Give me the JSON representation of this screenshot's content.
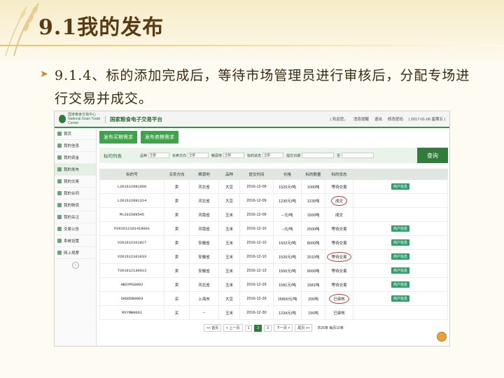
{
  "slide": {
    "title": "9.1我的发布",
    "bullet": "9.1.4、标的添加完成后，等待市场管理员进行审核后，分配专场进行交易并成交。"
  },
  "app": {
    "org": "国家粮食交易中心",
    "org_en": "National Grain Trade Center",
    "platform": "国家粮食电子交易平台",
    "welcome": "| 欢迎您，",
    "msg": "消息提醒",
    "logout": "退出",
    "change_pwd": "修改密码",
    "date": "| 2017-01-06 星期五 |"
  },
  "sidebar": {
    "items": [
      {
        "label": "首页"
      },
      {
        "label": "我的信息"
      },
      {
        "label": "我的资金"
      },
      {
        "label": "我的发布"
      },
      {
        "label": "我的交易"
      },
      {
        "label": "我的合同"
      },
      {
        "label": "我的物流"
      },
      {
        "label": "我的关注"
      },
      {
        "label": "交易公告"
      },
      {
        "label": "系统设置"
      },
      {
        "label": "网上观摩"
      }
    ]
  },
  "tabs": {
    "buy": "发布买粮需求",
    "sell": "发布卖粮需求"
  },
  "filter": {
    "title": "标的列表",
    "variety_label": "品种",
    "variety_val": "全部",
    "direction_label": "买卖方向",
    "direction_val": "全部",
    "origin_label": "粮源地",
    "origin_val": "全部",
    "status_label": "标的状态",
    "status_val": "全部",
    "date_label": "提交日期",
    "to_label": "至",
    "query": "查询"
  },
  "table": {
    "headers": [
      "标的号",
      "买卖方向",
      "粮源地",
      "品种",
      "提交时间",
      "价格",
      "标的数量",
      "标的状态",
      ""
    ],
    "rows": [
      {
        "id": "L201612091050",
        "dir": "卖",
        "origin": "河北省",
        "variety": "大豆",
        "date": "2016-12-09",
        "price": "1520元/吨",
        "qty": "1000吨",
        "status": "等待交易",
        "action": "商户信息"
      },
      {
        "id": "L201612091314",
        "dir": "卖",
        "origin": "河北省",
        "variety": "大豆",
        "date": "2016-12-09",
        "price": "1230元/吨",
        "qty": "1230吨",
        "status": "成交",
        "action": ""
      },
      {
        "id": "ML201589545",
        "dir": "卖",
        "origin": "河南省",
        "variety": "玉米",
        "date": "2016-12-09",
        "price": "--元/吨",
        "qty": "1500吨",
        "status": "成交",
        "action": ""
      },
      {
        "id": "P201612101418001",
        "dir": "卖",
        "origin": "河南省",
        "variety": "玉米",
        "date": "2016-12-10",
        "price": "--元/吨",
        "qty": "2500吨",
        "status": "等待交易",
        "action": "商户信息"
      },
      {
        "id": "V201612101827",
        "dir": "卖",
        "origin": "安徽省",
        "variety": "玉米",
        "date": "2016-12-10",
        "price": "1502元/吨",
        "qty": "8000吨",
        "status": "等待交易",
        "action": "商户信息"
      },
      {
        "id": "V201612101833",
        "dir": "卖",
        "origin": "安徽省",
        "variety": "玉米",
        "date": "2016-12-10",
        "price": "1520元/吨",
        "qty": "2010吨",
        "status": "等待交易",
        "action": "商户信息"
      },
      {
        "id": "T201612130913",
        "dir": "卖",
        "origin": "安徽省",
        "variety": "玉米",
        "date": "2016-12-13",
        "price": "1560元/吨",
        "qty": "9000吨",
        "status": "等待交易",
        "action": "商户信息"
      },
      {
        "id": "HBSYMS0002",
        "dir": "卖",
        "origin": "河北省",
        "variety": "玉米",
        "date": "2016-12-29",
        "price": "1581元/吨",
        "qty": "1581吨",
        "status": "等待交易",
        "action": "商户信息"
      },
      {
        "id": "SHSDDB0003",
        "dir": "买",
        "origin": "上海市",
        "variety": "大豆",
        "date": "2016-12-29",
        "price": "15800元/吨",
        "qty": "200吨",
        "status": "已审核",
        "action": "商户信息"
      },
      {
        "id": "MXYMB0001",
        "dir": "买",
        "origin": "--",
        "variety": "玉米",
        "date": "2016-12-30",
        "price": "1234元/吨",
        "qty": "150吨",
        "status": "已审核",
        "action": ""
      }
    ]
  },
  "pager": {
    "first": "<< 首页",
    "prev": "< 上一页",
    "p1": "1",
    "p2": "2",
    "p3": "3",
    "next": "下一页 >",
    "last": "尾页 >>",
    "info": "共26条 每页10条"
  }
}
